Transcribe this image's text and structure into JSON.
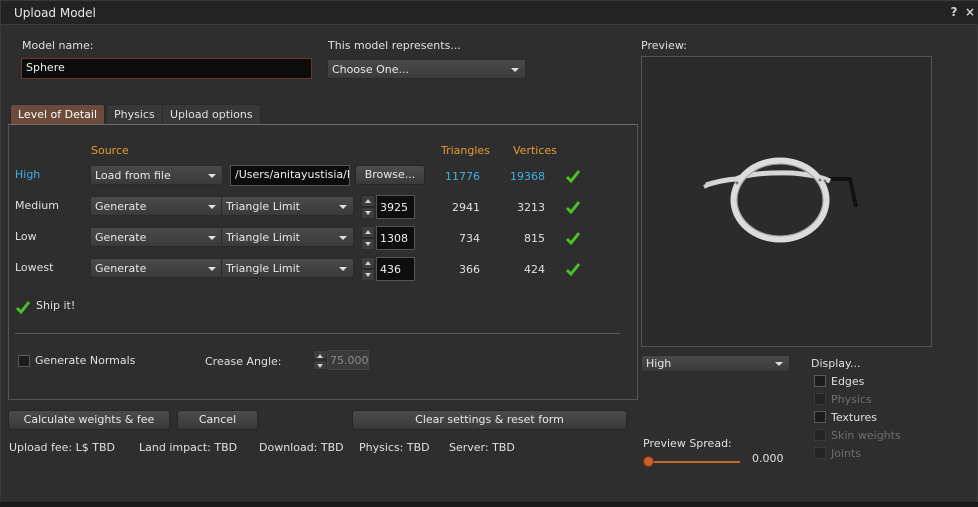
{
  "window": {
    "title": "Upload Model",
    "help_icon": "?",
    "close_icon": "×"
  },
  "model_name": {
    "label": "Model name:",
    "value": "Sphere"
  },
  "represents": {
    "label": "This model represents...",
    "value": "Choose One..."
  },
  "tabs": [
    {
      "label": "Level of Detail",
      "active": true
    },
    {
      "label": "Physics",
      "active": false
    },
    {
      "label": "Upload options",
      "active": false
    }
  ],
  "lod": {
    "headers": {
      "source": "Source",
      "triangles": "Triangles",
      "vertices": "Vertices"
    },
    "rows": [
      {
        "name": "High",
        "source": "Load from file",
        "file_path": "/Users/anitayustisia/D",
        "browse": "Browse...",
        "triangles": "11776",
        "vertices": "19368",
        "ok": true
      },
      {
        "name": "Medium",
        "source": "Generate",
        "method": "Triangle Limit",
        "limit": "3925",
        "triangles": "2941",
        "vertices": "3213",
        "ok": true
      },
      {
        "name": "Low",
        "source": "Generate",
        "method": "Triangle Limit",
        "limit": "1308",
        "triangles": "734",
        "vertices": "815",
        "ok": true
      },
      {
        "name": "Lowest",
        "source": "Generate",
        "method": "Triangle Limit",
        "limit": "436",
        "triangles": "366",
        "vertices": "424",
        "ok": true
      }
    ],
    "ship_it": "Ship it!",
    "generate_normals": "Generate Normals",
    "crease_angle_label": "Crease Angle:",
    "crease_angle_value": "75.000"
  },
  "buttons": {
    "calculate": "Calculate weights & fee",
    "cancel": "Cancel",
    "clear": "Clear settings & reset form"
  },
  "status": {
    "upload_fee": "Upload fee: L$ TBD",
    "land_impact": "Land impact: TBD",
    "download": "Download: TBD",
    "physics": "Physics: TBD",
    "server": "Server: TBD"
  },
  "preview": {
    "label": "Preview:",
    "lod_select": "High",
    "display_label": "Display...",
    "display_options": [
      {
        "label": "Edges",
        "enabled": true,
        "checked": false
      },
      {
        "label": "Physics",
        "enabled": false,
        "checked": false
      },
      {
        "label": "Textures",
        "enabled": true,
        "checked": false
      },
      {
        "label": "Skin weights",
        "enabled": false,
        "checked": false
      },
      {
        "label": "Joints",
        "enabled": false,
        "checked": false
      }
    ],
    "spread_label": "Preview Spread:",
    "spread_value": "0.000"
  },
  "colors": {
    "accent_orange": "#e69a2e",
    "accent_blue": "#3fb0e6",
    "check_green": "#4cc024",
    "active_tab": "#6d4b3a"
  }
}
